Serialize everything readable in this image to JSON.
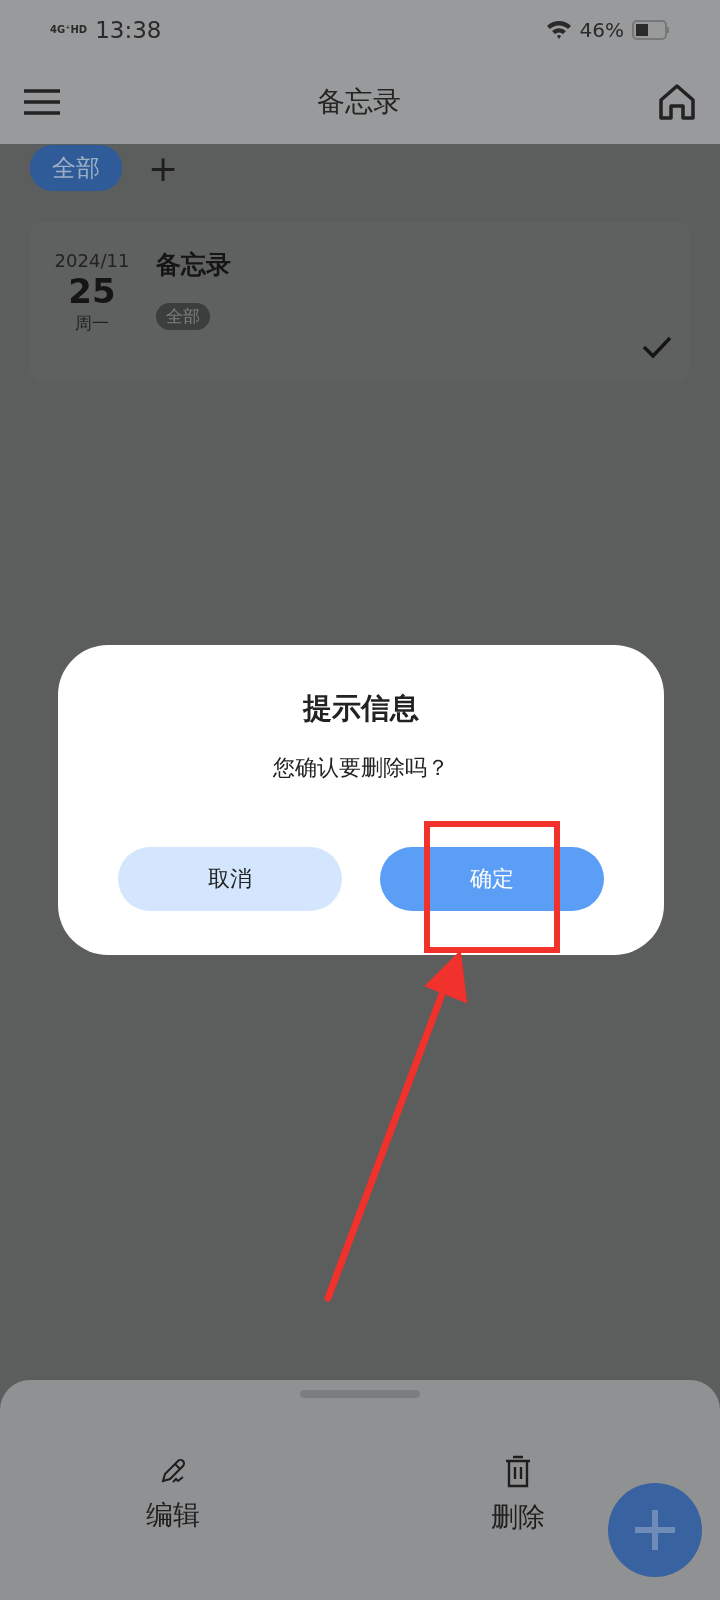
{
  "status_bar": {
    "network": "4G⁺HD",
    "time": "13:38",
    "battery": "46%"
  },
  "header": {
    "title": "备忘录"
  },
  "filters": [
    {
      "label": "全部",
      "selected": true
    }
  ],
  "add_filter": "+",
  "notes": [
    {
      "date": "2024/11",
      "day": "25",
      "weekday": "周一",
      "title": "备忘录",
      "tag": "全部",
      "checked": true
    }
  ],
  "dialog": {
    "title": "提示信息",
    "message": "您确认要删除吗？",
    "buttons": [
      {
        "label": "取消",
        "kind": "secondary"
      },
      {
        "label": "确定",
        "kind": "primary"
      }
    ]
  },
  "annotation": {
    "highlighted": true
  },
  "bottom_sheet": {
    "actions": [
      {
        "label": "编辑",
        "kind": "edit"
      },
      {
        "label": "删除",
        "kind": "delete"
      }
    ]
  }
}
